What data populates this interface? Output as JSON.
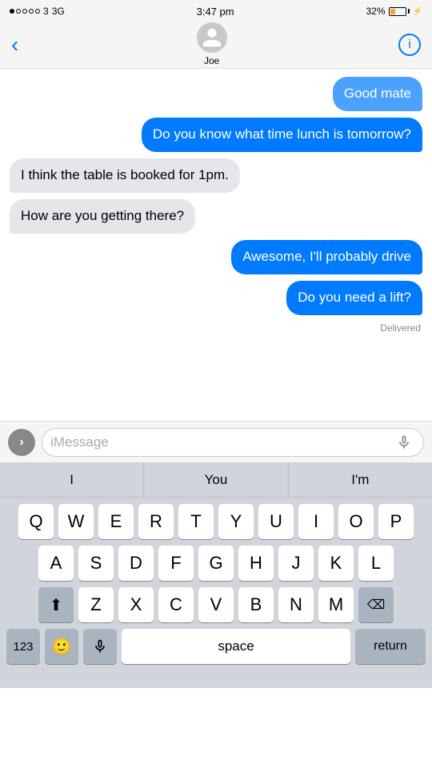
{
  "statusBar": {
    "carrier": "3",
    "networkType": "3G",
    "time": "3:47 pm",
    "batteryPercent": "32%",
    "batteryColor": "#f5a623"
  },
  "navBar": {
    "contactName": "Joe",
    "backLabel": "‹",
    "infoLabel": "i"
  },
  "messages": [
    {
      "id": 1,
      "type": "outgoing",
      "text": "Good mate",
      "partial": true
    },
    {
      "id": 2,
      "type": "outgoing",
      "text": "Do you know what time lunch is tomorrow?"
    },
    {
      "id": 3,
      "type": "incoming",
      "text": "I think the table is booked for 1pm."
    },
    {
      "id": 4,
      "type": "incoming",
      "text": "How are you getting there?"
    },
    {
      "id": 5,
      "type": "outgoing",
      "text": "Awesome, I'll probably drive"
    },
    {
      "id": 6,
      "type": "outgoing",
      "text": "Do you need a lift?"
    },
    {
      "id": 7,
      "type": "delivered",
      "text": "Delivered"
    }
  ],
  "inputBar": {
    "placeholder": "iMessage",
    "expandIcon": "›",
    "micIcon": "mic"
  },
  "autocomplete": {
    "items": [
      "I",
      "You",
      "I'm"
    ]
  },
  "keyboard": {
    "row1": [
      "Q",
      "W",
      "E",
      "R",
      "T",
      "Y",
      "U",
      "I",
      "O",
      "P"
    ],
    "row2": [
      "A",
      "S",
      "D",
      "F",
      "G",
      "H",
      "J",
      "K",
      "L"
    ],
    "row3": [
      "Z",
      "X",
      "C",
      "V",
      "B",
      "N",
      "M"
    ],
    "bottomLeft": "123",
    "bottomReturn": "return",
    "bottomSpace": "space"
  }
}
